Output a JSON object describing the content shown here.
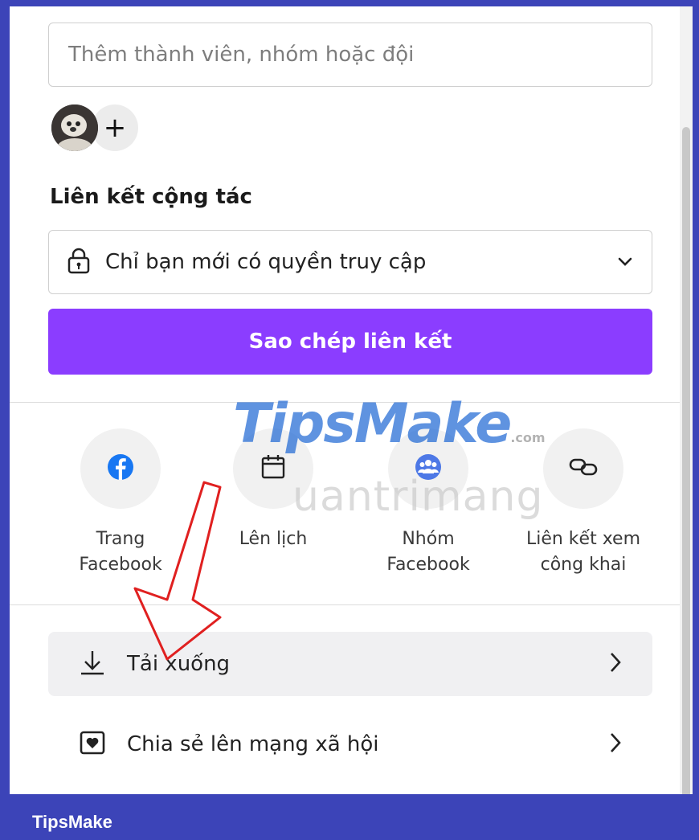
{
  "member_search": {
    "placeholder": "Thêm thành viên, nhóm hoặc đội"
  },
  "collaboration": {
    "heading": "Liên kết cộng tác",
    "access_label": "Chỉ bạn mới có quyền truy cập",
    "copy_link_button": "Sao chép liên kết"
  },
  "share_targets": [
    {
      "label_line1": "Trang",
      "label_line2": "Facebook",
      "icon": "facebook-icon"
    },
    {
      "label_line1": "Lên lịch",
      "label_line2": "",
      "icon": "calendar-icon"
    },
    {
      "label_line1": "Nhóm",
      "label_line2": "Facebook",
      "icon": "facebook-group-icon"
    },
    {
      "label_line1": "Liên kết xem",
      "label_line2": "công khai",
      "icon": "link-icon"
    }
  ],
  "menu": [
    {
      "label": "Tải xuống",
      "icon": "download-icon"
    },
    {
      "label": "Chia sẻ lên mạng xã hội",
      "icon": "heart-box-icon"
    }
  ],
  "watermarks": {
    "brand": "TipsMake",
    "brand_domain": ".com",
    "secondary": "uantrimang"
  },
  "footer": {
    "brand": "TipsMake"
  },
  "colors": {
    "primary": "#8b3dff",
    "frame": "#3c44b8",
    "facebook": "#1877f2"
  }
}
